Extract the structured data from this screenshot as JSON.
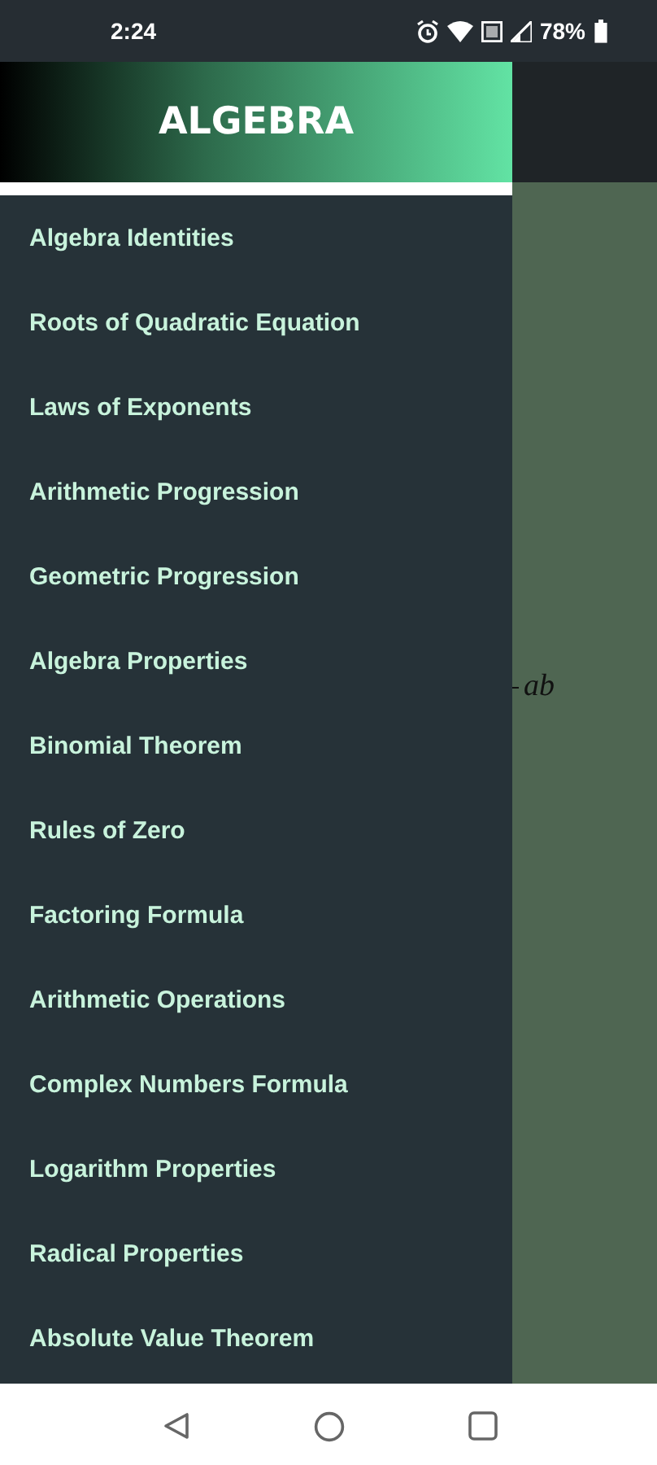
{
  "status_bar": {
    "time": "2:24",
    "battery": "78%"
  },
  "drawer": {
    "title": "ALGEBRA",
    "items": [
      {
        "label": "Algebra Identities"
      },
      {
        "label": "Roots of Quadratic Equation"
      },
      {
        "label": "Laws of Exponents"
      },
      {
        "label": "Arithmetic Progression"
      },
      {
        "label": "Geometric Progression"
      },
      {
        "label": "Algebra Properties"
      },
      {
        "label": "Binomial Theorem"
      },
      {
        "label": "Rules of Zero"
      },
      {
        "label": "Factoring Formula"
      },
      {
        "label": "Arithmetic Operations"
      },
      {
        "label": "Complex Numbers Formula"
      },
      {
        "label": "Logarithm Properties"
      },
      {
        "label": "Radical Properties"
      },
      {
        "label": "Absolute Value Theorem"
      }
    ]
  },
  "content": {
    "formula_fragment": "ab"
  }
}
